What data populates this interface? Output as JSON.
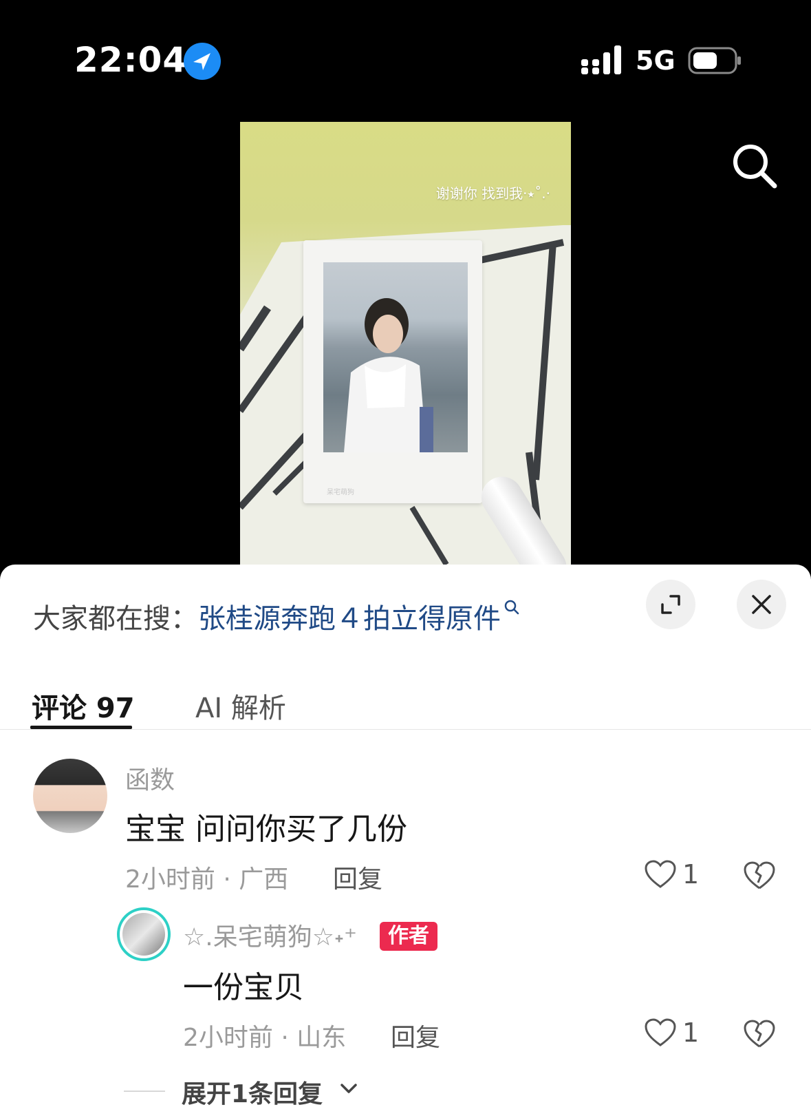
{
  "status_bar": {
    "time": "22:04",
    "network": "5G",
    "icons": [
      "location-arrow-icon",
      "signal-icon",
      "battery-icon"
    ]
  },
  "video": {
    "overlay_text": "谢谢你 找到我·⭑˚.·",
    "photo_watermark": "呆宅萌狗",
    "search_icon": "search-icon"
  },
  "sheet": {
    "hot_search_prefix": "大家都在搜：",
    "hot_search_query": "张桂源奔跑４拍立得原件",
    "expand_icon": "expand-icon",
    "close_icon": "close-icon",
    "tabs": [
      {
        "label": "评论 97",
        "active": true
      },
      {
        "label": "AI 解析",
        "active": false
      }
    ]
  },
  "comments": [
    {
      "username": "函数",
      "text": "宝宝 问问你买了几份",
      "meta": "2小时前 · 广西",
      "reply_label": "回复",
      "likes": "1",
      "reply": {
        "username": "☆.呆宅萌狗☆˖⁺",
        "badge": "作者",
        "text": "一份宝贝",
        "meta": "2小时前 · 山东",
        "reply_label": "回复",
        "likes": "1"
      },
      "expand_label": "展开1条回复"
    }
  ],
  "colors": {
    "accent_query": "#204a86",
    "author_badge": "#ec2a4f",
    "location_blue": "#1c8cf5"
  }
}
